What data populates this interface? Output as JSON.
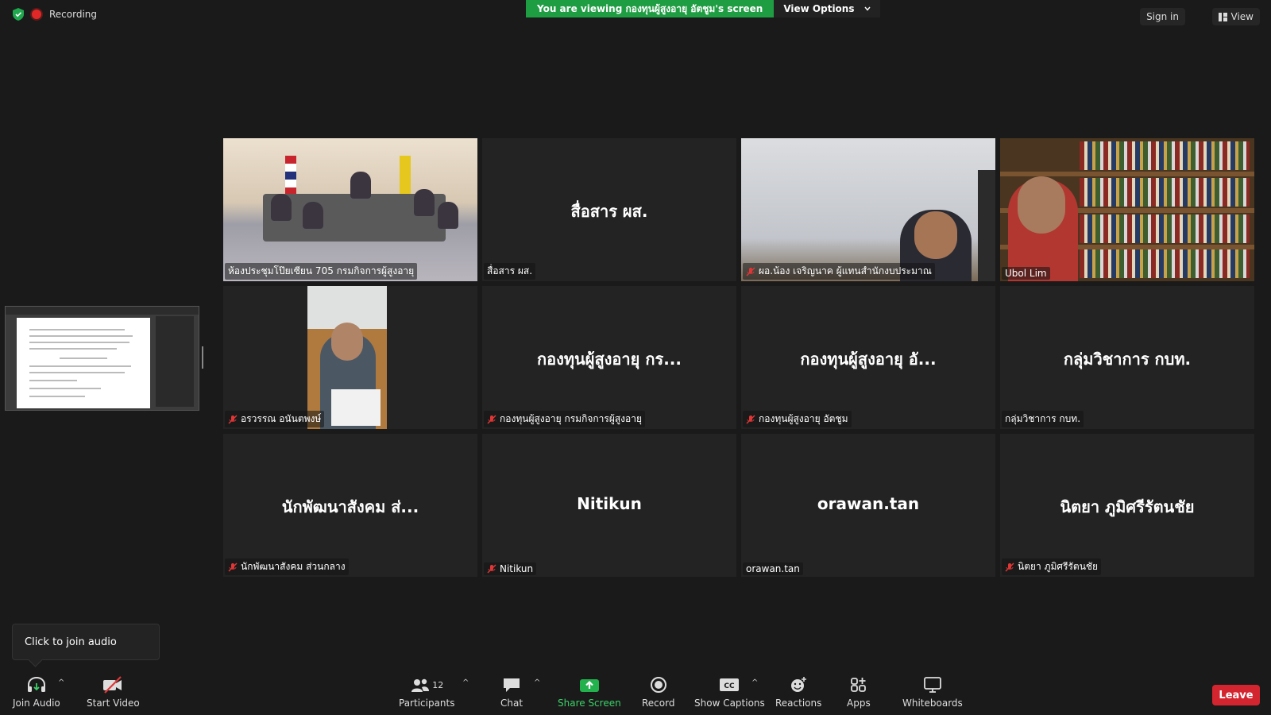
{
  "top": {
    "recording_label": "Recording",
    "viewing_text": "You are viewing กองทุนผู้สูงอายุ อัตชูม's screen",
    "view_options_label": "View Options",
    "sign_in_label": "Sign in",
    "view_label": "View"
  },
  "tiles": [
    {
      "big": "",
      "label": "ห้องประชุมโป๊ยเซียน 705 กรมกิจการผู้สูงอายุ",
      "muted": false
    },
    {
      "big": "สื่อสาร ผส.",
      "label": "สื่อสาร ผส.",
      "muted": false
    },
    {
      "big": "",
      "label": "ผอ.น้อง เจริญนาค ผู้แทนสำนักงบประมาณ",
      "muted": true
    },
    {
      "big": "",
      "label": "Ubol Lim",
      "muted": false
    },
    {
      "big": "",
      "label": "อรวรรณ อนันตพงษ์",
      "muted": true
    },
    {
      "big": "กองทุนผู้สูงอายุ กร...",
      "label": "กองทุนผู้สูงอายุ กรมกิจการผู้สูงอายุ",
      "muted": true
    },
    {
      "big": "กองทุนผู้สูงอายุ อั...",
      "label": "กองทุนผู้สูงอายุ อัตชูม",
      "muted": true
    },
    {
      "big": "กลุ่มวิชาการ กบท.",
      "label": "กลุ่มวิชาการ กบท.",
      "muted": false
    },
    {
      "big": "นักพัฒนาสังคม ส่...",
      "label": "นักพัฒนาสังคม ส่วนกลาง",
      "muted": true
    },
    {
      "big": "Nitikun",
      "label": "Nitikun",
      "muted": true
    },
    {
      "big": "orawan.tan",
      "label": "orawan.tan",
      "muted": false
    },
    {
      "big": "นิตยา ภูมิศรีรัตนชัย",
      "label": "นิตยา ภูมิศรีรัตนชัย",
      "muted": true
    }
  ],
  "tooltip": {
    "text": "Click to join audio"
  },
  "toolbar": {
    "join_audio": "Join Audio",
    "start_video": "Start Video",
    "participants": "Participants",
    "participants_count": "12",
    "chat": "Chat",
    "share_screen": "Share Screen",
    "record": "Record",
    "show_captions": "Show Captions",
    "reactions": "Reactions",
    "apps": "Apps",
    "whiteboards": "Whiteboards",
    "leave": "Leave"
  },
  "colors": {
    "share_green": "#1f9d43",
    "active_outline": "#d7e631",
    "leave_red": "#d3252f"
  }
}
